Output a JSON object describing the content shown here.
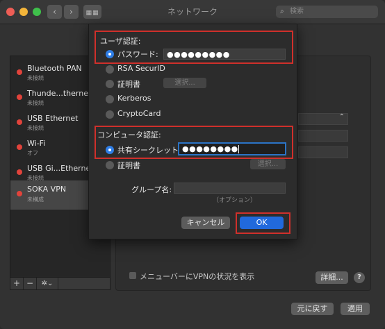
{
  "window": {
    "title": "ネットワーク"
  },
  "search": {
    "placeholder": "検索"
  },
  "services": [
    {
      "name": "Bluetooth PAN",
      "status": "未接続"
    },
    {
      "name": "Thunde...thernet",
      "status": "未接続"
    },
    {
      "name": "USB Ethernet",
      "status": "未接続"
    },
    {
      "name": "Wi-Fi",
      "status": "オフ"
    },
    {
      "name": "USB Gi...Ethernet",
      "status": "未接続"
    },
    {
      "name": "SOKA VPN",
      "status": "未構成"
    }
  ],
  "sidebar_buttons": {
    "add": "+",
    "remove": "−",
    "action": "✲⌄"
  },
  "main": {
    "show_vpn_status_label": "メニューバーにVPNの状況を表示",
    "advanced_button": "詳細...",
    "help": "?",
    "revert_button": "元に戻す",
    "apply_button": "適用"
  },
  "sheet": {
    "user_auth": {
      "heading": "ユーザ認証:",
      "options": [
        "パスワード:",
        "RSA SecurID",
        "証明書",
        "Kerberos",
        "CryptoCard"
      ],
      "selected": "パスワード:",
      "password_value": "●●●●●●●●●",
      "cert_select_button": "選択..."
    },
    "computer_auth": {
      "heading": "コンピュータ認証:",
      "options": [
        "共有シークレット:",
        "証明書"
      ],
      "selected": "共有シークレット:",
      "secret_value": "●●●●●●●●",
      "cert_select_button": "選択..."
    },
    "group_name": {
      "label": "グループ名:",
      "hint": "（オプション）"
    },
    "cancel_button": "キャンセル",
    "ok_button": "OK"
  },
  "colors": {
    "highlight": "#d0302b",
    "accent": "#2f7ee6",
    "status_red": "#e2433b"
  }
}
